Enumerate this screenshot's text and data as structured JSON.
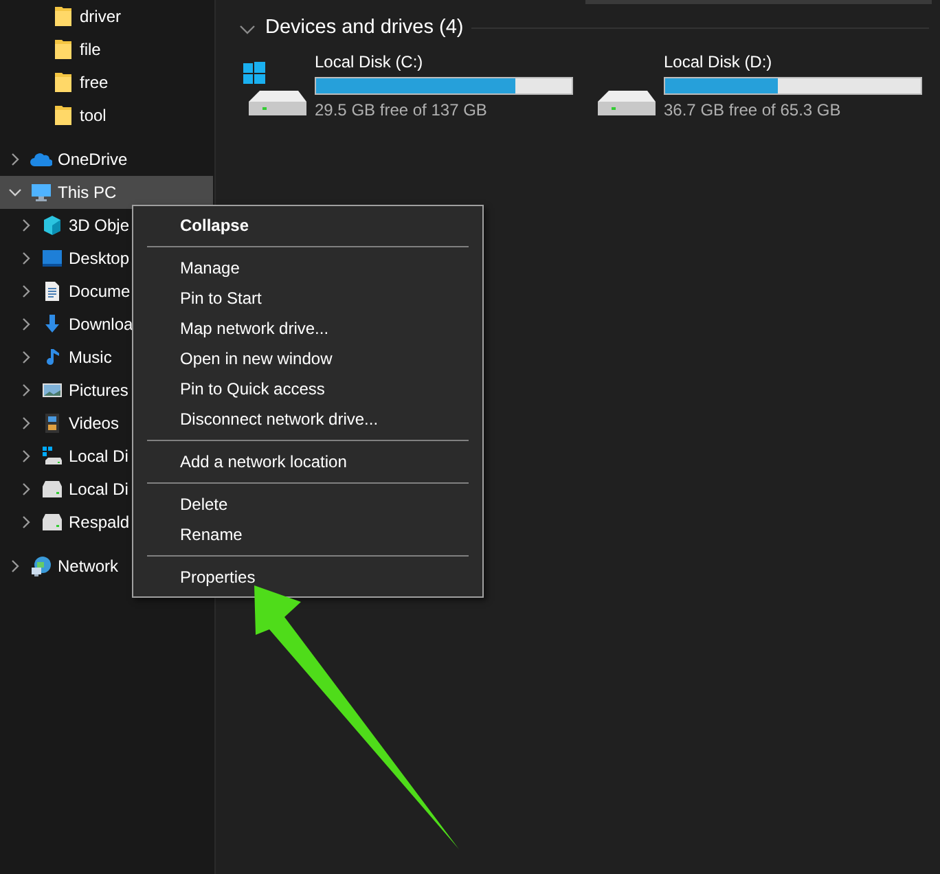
{
  "sidebar": {
    "folder_children": [
      {
        "label": "driver"
      },
      {
        "label": "file"
      },
      {
        "label": "free"
      },
      {
        "label": "tool"
      }
    ],
    "items": [
      {
        "label": "OneDrive",
        "kind": "cloud",
        "selected": false,
        "expanded": false
      },
      {
        "label": "This PC",
        "kind": "pc",
        "selected": true,
        "expanded": true,
        "children": [
          {
            "label": "3D Obje",
            "kind": "cube"
          },
          {
            "label": "Desktop",
            "kind": "desktop"
          },
          {
            "label": "Docume",
            "kind": "doc"
          },
          {
            "label": "Downloa",
            "kind": "download"
          },
          {
            "label": "Music",
            "kind": "music"
          },
          {
            "label": "Pictures",
            "kind": "pictures"
          },
          {
            "label": "Videos",
            "kind": "videos"
          },
          {
            "label": "Local Di",
            "kind": "windrive"
          },
          {
            "label": "Local Di",
            "kind": "drive"
          },
          {
            "label": "Respald",
            "kind": "drive"
          }
        ]
      },
      {
        "label": "Network",
        "kind": "network",
        "selected": false,
        "expanded": false
      }
    ]
  },
  "section": {
    "title": "Devices and drives (4)",
    "expanded": true
  },
  "drives": [
    {
      "name": "Local Disk (C:)",
      "system": true,
      "level": 0.78,
      "reading": "29.5 GB free of 137 GB"
    },
    {
      "name": "Local Disk (D:)",
      "system": false,
      "level": 0.44,
      "reading": "36.7 GB free of 65.3 GB"
    }
  ],
  "context_menu": {
    "groups": [
      [
        {
          "label": "Collapse",
          "default": true
        }
      ],
      [
        {
          "label": "Manage",
          "default": false
        },
        {
          "label": "Pin to Start",
          "default": false
        },
        {
          "label": "Map network drive...",
          "default": false
        },
        {
          "label": "Open in new window",
          "default": false
        },
        {
          "label": "Pin to Quick access",
          "default": false
        },
        {
          "label": "Disconnect network drive...",
          "default": false
        }
      ],
      [
        {
          "label": "Add a network location",
          "default": false
        }
      ],
      [
        {
          "label": "Delete",
          "default": false
        },
        {
          "label": "Rename",
          "default": false
        }
      ],
      [
        {
          "label": "Properties",
          "default": false
        }
      ]
    ]
  }
}
